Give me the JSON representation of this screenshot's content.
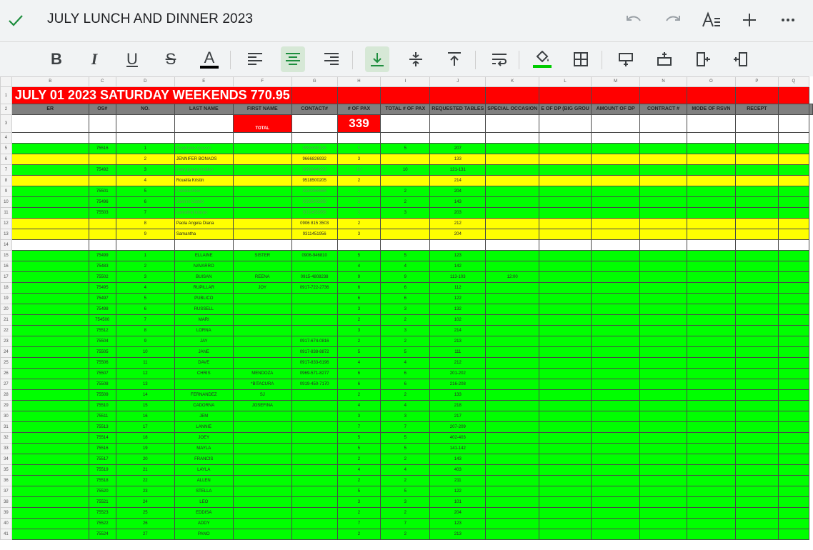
{
  "app": {
    "title": "JULY LUNCH AND DINNER 2023",
    "icons": [
      "check-icon",
      "undo-icon",
      "redo-icon",
      "text-format-icon",
      "add-icon",
      "more-icon"
    ]
  },
  "toolbar": {
    "buttons": [
      "bold",
      "italic",
      "underline",
      "strikethrough",
      "text-color",
      "align-left",
      "align-center",
      "align-right",
      "valign-bottom",
      "valign-middle",
      "valign-top",
      "wrap",
      "fill-color",
      "borders",
      "insert-row-above",
      "insert-row-below",
      "insert-col-left",
      "insert-col-right"
    ],
    "bold_glyph": "B",
    "italic_glyph": "I",
    "underline_glyph": "U",
    "strike_glyph": "S",
    "textcolor_glyph": "A",
    "active_color": "#1e8e3e"
  },
  "sheet": {
    "columns": [
      "",
      "B",
      "C",
      "D",
      "E",
      "F",
      "G",
      "H",
      "I",
      "J",
      "K",
      "L",
      "M",
      "N",
      "O",
      "P",
      "Q"
    ],
    "title": "JULY 01 2023 SATURDAY WEEKENDS 770.95",
    "headers": [
      "ER",
      "OS#",
      "NO.",
      "LAST NAME",
      "FIRST NAME",
      "CONTACT#",
      "# OF PAX",
      "TOTAL # OF PAX",
      "REQUESTED TABLES",
      "SPECIAL OCCASION",
      "E OF DP (BIG GROU",
      "AMOUNT OF DP",
      "CONTRACT #",
      "MODE OF RSVN",
      "RECEPT",
      "",
      ""
    ],
    "total_label": "TOTAL",
    "total_value": "339",
    "rows": [
      {
        "n": "5",
        "style": "green",
        "os": "75516",
        "no": "1",
        "last": "Stephanie Apuson",
        "first": "",
        "contact": "9994069126",
        "pax": "5",
        "total": "5",
        "tables": "207",
        "occasion": "",
        "faded": true
      },
      {
        "n": "6",
        "style": "yellow",
        "os": "",
        "no": "2",
        "last": "JENNIFER BONAOS",
        "first": "",
        "contact": "9666826932",
        "pax": "3",
        "total": "",
        "tables": "133",
        "occasion": "",
        "faded": false
      },
      {
        "n": "7",
        "style": "green",
        "os": "75492",
        "no": "3",
        "last": "mary grace micdao",
        "first": "",
        "contact": "9192044223",
        "pax": "10",
        "total": "10",
        "tables": "121-131",
        "occasion": "",
        "faded": true
      },
      {
        "n": "8",
        "style": "yellow",
        "os": "",
        "no": "4",
        "last": "Rouella Kristin",
        "first": "",
        "contact": "9518500205",
        "pax": "2",
        "total": "",
        "tables": "214",
        "occasion": "",
        "faded": false
      },
      {
        "n": "9",
        "style": "green",
        "os": "75501",
        "no": "5",
        "last": "Patricia Alon",
        "first": "",
        "contact": "9183364565",
        "pax": "2",
        "total": "2",
        "tables": "204",
        "occasion": "",
        "faded": true
      },
      {
        "n": "10",
        "style": "green",
        "os": "75496",
        "no": "6",
        "last": "Jasmin Castro",
        "first": "",
        "contact": "9153543289",
        "pax": "2",
        "total": "2",
        "tables": "143",
        "occasion": "",
        "faded": true
      },
      {
        "n": "11",
        "style": "green",
        "os": "75503",
        "no": "7",
        "last": "samatha fararao",
        "first": "",
        "contact": "9311451956",
        "pax": "3",
        "total": "3",
        "tables": "203",
        "occasion": "",
        "faded": true
      },
      {
        "n": "12",
        "style": "yellow",
        "os": "",
        "no": "8",
        "last": "Paola Angela Diana",
        "first": "",
        "contact": "0906 815 3503",
        "pax": "2",
        "total": "",
        "tables": "212",
        "occasion": "",
        "faded": false
      },
      {
        "n": "13",
        "style": "yellow",
        "os": "",
        "no": "9",
        "last": "Samantha",
        "first": "",
        "contact": "9311451956",
        "pax": "3",
        "total": "",
        "tables": "204",
        "occasion": "",
        "faded": false
      },
      {
        "n": "14",
        "style": "white",
        "os": "",
        "no": "",
        "last": "",
        "first": "",
        "contact": "",
        "pax": "",
        "total": "",
        "tables": "",
        "occasion": "",
        "faded": false
      },
      {
        "n": "15",
        "style": "green",
        "os": "75499",
        "no": "1",
        "last": "ELLAINE",
        "first": "SISTER",
        "contact": "0906-946810",
        "pax": "5",
        "total": "5",
        "tables": "123",
        "occasion": "",
        "faded": false
      },
      {
        "n": "16",
        "style": "green",
        "os": "75483",
        "no": "2",
        "last": "NAVARRO",
        "first": "",
        "contact": "",
        "pax": "4",
        "total": "4",
        "tables": "142",
        "occasion": "",
        "faded": false
      },
      {
        "n": "17",
        "style": "green",
        "os": "75502",
        "no": "3",
        "last": "BUISAN",
        "first": "REENA",
        "contact": "0915-4808238",
        "pax": "9",
        "total": "9",
        "tables": "113-103",
        "occasion": "12:00",
        "faded": false
      },
      {
        "n": "18",
        "style": "green",
        "os": "75495",
        "no": "4",
        "last": "RUPILLAR",
        "first": "JOY",
        "contact": "0917-722-2736",
        "pax": "6",
        "total": "6",
        "tables": "112",
        "occasion": "",
        "faded": false
      },
      {
        "n": "19",
        "style": "green",
        "os": "75497",
        "no": "5",
        "last": "PUBLICO",
        "first": "",
        "contact": "",
        "pax": "6",
        "total": "6",
        "tables": "122",
        "occasion": "",
        "faded": false
      },
      {
        "n": "20",
        "style": "green",
        "os": "75498",
        "no": "6",
        "last": "RUSSELL",
        "first": "",
        "contact": "",
        "pax": "3",
        "total": "3",
        "tables": "132",
        "occasion": "",
        "faded": false
      },
      {
        "n": "21",
        "style": "green",
        "os": "754500",
        "no": "7",
        "last": "MARI",
        "first": "",
        "contact": "",
        "pax": "2",
        "total": "2",
        "tables": "102",
        "occasion": "",
        "faded": false
      },
      {
        "n": "22",
        "style": "green",
        "os": "75512",
        "no": "8",
        "last": "LORNA",
        "first": "",
        "contact": "",
        "pax": "3",
        "total": "3",
        "tables": "214",
        "occasion": "",
        "faded": false
      },
      {
        "n": "23",
        "style": "green",
        "os": "75504",
        "no": "9",
        "last": "JAY",
        "first": "",
        "contact": "0917-674-0816",
        "pax": "2",
        "total": "2",
        "tables": "213",
        "occasion": "",
        "faded": false
      },
      {
        "n": "24",
        "style": "green",
        "os": "75505",
        "no": "10",
        "last": "JANE",
        "first": "",
        "contact": "0917-838-8872",
        "pax": "5",
        "total": "5",
        "tables": "111",
        "occasion": "",
        "faded": false
      },
      {
        "n": "25",
        "style": "green",
        "os": "75506",
        "no": "11",
        "last": "DAVE",
        "first": "",
        "contact": "0917-833-6196",
        "pax": "4",
        "total": "4",
        "tables": "212",
        "occasion": "",
        "faded": false
      },
      {
        "n": "26",
        "style": "green",
        "os": "75507",
        "no": "12",
        "last": "CHRIS",
        "first": "MENDOZA",
        "contact": "0969-571-8277",
        "pax": "6",
        "total": "6",
        "tables": "201-202",
        "occasion": "",
        "faded": false
      },
      {
        "n": "27",
        "style": "green",
        "os": "75508",
        "no": "13",
        "last": "",
        "first": "*BITACURA",
        "contact": "0919-450-7170",
        "pax": "6",
        "total": "6",
        "tables": "216-208",
        "occasion": "",
        "faded": false
      },
      {
        "n": "28",
        "style": "green",
        "os": "75509",
        "no": "14",
        "last": "FERNANDEZ",
        "first": "SJ",
        "contact": "",
        "pax": "2",
        "total": "2",
        "tables": "133",
        "occasion": "",
        "faded": false
      },
      {
        "n": "29",
        "style": "green",
        "os": "75510",
        "no": "15",
        "last": "CADORNA",
        "first": "JOSEFINA",
        "contact": "",
        "pax": "4",
        "total": "4",
        "tables": "218",
        "occasion": "",
        "faded": false
      },
      {
        "n": "30",
        "style": "green",
        "os": "75511",
        "no": "16",
        "last": "JEM",
        "first": "",
        "contact": "",
        "pax": "3",
        "total": "3",
        "tables": "217",
        "occasion": "",
        "faded": false
      },
      {
        "n": "31",
        "style": "green",
        "os": "75513",
        "no": "17",
        "last": "LANNIE",
        "first": "",
        "contact": "",
        "pax": "7",
        "total": "7",
        "tables": "207-209",
        "occasion": "",
        "faded": false
      },
      {
        "n": "32",
        "style": "green",
        "os": "75514",
        "no": "18",
        "last": "JOEY",
        "first": "",
        "contact": "",
        "pax": "5",
        "total": "5",
        "tables": "402-403",
        "occasion": "",
        "faded": false
      },
      {
        "n": "33",
        "style": "green",
        "os": "75516",
        "no": "19",
        "last": "MAYLA",
        "first": "",
        "contact": "",
        "pax": "5",
        "total": "5",
        "tables": "141-142",
        "occasion": "",
        "faded": false
      },
      {
        "n": "34",
        "style": "green",
        "os": "75517",
        "no": "20",
        "last": "FRANCIS",
        "first": "",
        "contact": "",
        "pax": "2",
        "total": "2",
        "tables": "143",
        "occasion": "",
        "faded": false
      },
      {
        "n": "35",
        "style": "green",
        "os": "75519",
        "no": "21",
        "last": "LAYLA",
        "first": "",
        "contact": "",
        "pax": "4",
        "total": "4",
        "tables": "403",
        "occasion": "",
        "faded": false
      },
      {
        "n": "36",
        "style": "green",
        "os": "75518",
        "no": "22",
        "last": "ALLEN",
        "first": "",
        "contact": "",
        "pax": "2",
        "total": "2",
        "tables": "211",
        "occasion": "",
        "faded": false
      },
      {
        "n": "37",
        "style": "green",
        "os": "75520",
        "no": "23",
        "last": "STELLA",
        "first": "",
        "contact": "",
        "pax": "5",
        "total": "5",
        "tables": "122",
        "occasion": "",
        "faded": false
      },
      {
        "n": "38",
        "style": "green",
        "os": "75521",
        "no": "24",
        "last": "LEO",
        "first": "",
        "contact": "",
        "pax": "3",
        "total": "3",
        "tables": "101",
        "occasion": "",
        "faded": false
      },
      {
        "n": "39",
        "style": "green",
        "os": "75523",
        "no": "25",
        "last": "EDDISA",
        "first": "",
        "contact": "",
        "pax": "2",
        "total": "2",
        "tables": "204",
        "occasion": "",
        "faded": false
      },
      {
        "n": "40",
        "style": "green",
        "os": "75522",
        "no": "26",
        "last": "ADDY",
        "first": "",
        "contact": "",
        "pax": "7",
        "total": "7",
        "tables": "123",
        "occasion": "",
        "faded": false
      },
      {
        "n": "41",
        "style": "green",
        "os": "75524",
        "no": "27",
        "last": "PANO",
        "first": "",
        "contact": "",
        "pax": "2",
        "total": "2",
        "tables": "213",
        "occasion": "",
        "faded": false
      }
    ]
  }
}
